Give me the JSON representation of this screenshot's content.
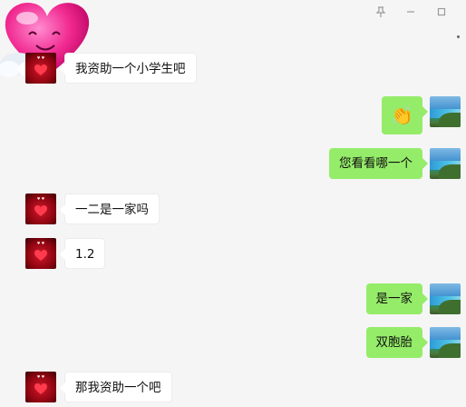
{
  "window": {
    "controls": [
      {
        "name": "pin-icon",
        "glyph": "⊥"
      },
      {
        "name": "minimize-icon",
        "glyph": "—"
      },
      {
        "name": "maximize-icon",
        "glyph": "▢"
      }
    ]
  },
  "messages": [
    {
      "side": "left",
      "text": "我资助一个小学生吧"
    },
    {
      "side": "right",
      "text": "👏"
    },
    {
      "side": "right",
      "text": "您看看哪一个"
    },
    {
      "side": "left",
      "text": "一二是一家吗"
    },
    {
      "side": "left",
      "text": "1.2"
    },
    {
      "side": "right",
      "text": "是一家"
    },
    {
      "side": "right",
      "text": "双胞胎"
    },
    {
      "side": "left",
      "text": "那我资助一个吧"
    }
  ],
  "colors": {
    "background": "#f5f5f5",
    "incoming_bubble": "#ffffff",
    "outgoing_bubble": "#95ec69"
  }
}
